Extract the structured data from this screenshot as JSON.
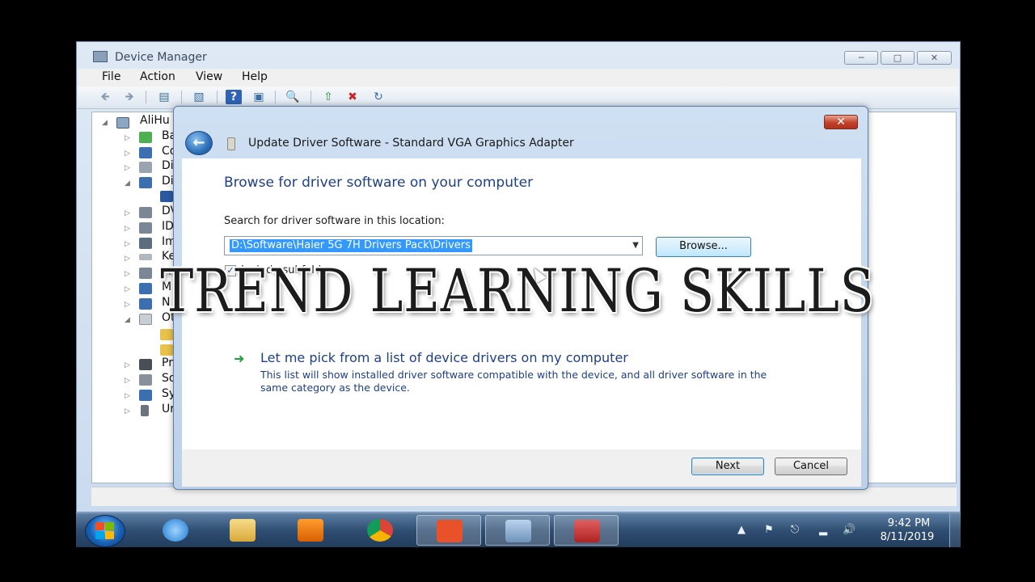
{
  "device_manager": {
    "title": "Device Manager",
    "menu": [
      "File",
      "Action",
      "View",
      "Help"
    ],
    "tree": [
      {
        "label": "AliHu",
        "icon": "computer-icon"
      },
      {
        "label": "Ba",
        "icon": "battery-icon"
      },
      {
        "label": "Co",
        "icon": "computer-icon"
      },
      {
        "label": "Di",
        "icon": "disk-drive-icon"
      },
      {
        "label": "Di",
        "icon": "display-adapter-icon"
      },
      {
        "label": "",
        "icon": "vga-adapter-icon"
      },
      {
        "label": "DV",
        "icon": "dvd-drive-icon"
      },
      {
        "label": "ID",
        "icon": "ide-controller-icon"
      },
      {
        "label": "Im",
        "icon": "imaging-device-icon"
      },
      {
        "label": "Ke",
        "icon": "keyboard-icon"
      },
      {
        "label": "M",
        "icon": "mouse-icon"
      },
      {
        "label": "M",
        "icon": "monitor-icon"
      },
      {
        "label": "N",
        "icon": "network-adapter-icon"
      },
      {
        "label": "Ot",
        "icon": "other-devices-icon"
      },
      {
        "label": "",
        "icon": "unknown-device-icon"
      },
      {
        "label": "",
        "icon": "unknown-device-icon"
      },
      {
        "label": "Pr",
        "icon": "processor-icon"
      },
      {
        "label": "So",
        "icon": "sound-icon"
      },
      {
        "label": "Sy",
        "icon": "system-devices-icon"
      },
      {
        "label": "Ur",
        "icon": "usb-controller-icon"
      }
    ]
  },
  "dialog": {
    "header": "Update Driver Software - Standard VGA Graphics Adapter",
    "heading": "Browse for driver software on your computer",
    "search_label": "Search for driver software in this location:",
    "path_value": "D:\\Software\\Haier 5G 7H Drivers Pack\\Drivers",
    "browse_label": "Browse...",
    "include_subfolders_label": "Include subfolders",
    "include_subfolders_checked": true,
    "pick_title": "Let me pick from a list of device drivers on my computer",
    "pick_description": "This list will show installed driver software compatible with the device, and all driver software in the same category as the device.",
    "next_label": "Next",
    "cancel_label": "Cancel"
  },
  "watermark": "TREND LEARNING SKILLS",
  "taskbar": {
    "apps": [
      "internet-explorer-icon",
      "windows-explorer-icon",
      "media-player-icon",
      "chrome-icon",
      "camtasia-icon",
      "device-manager-icon",
      "toolbox-icon"
    ],
    "clock_time": "9:42 PM",
    "clock_date": "8/11/2019"
  },
  "colors": {
    "heading_blue": "#1e3f8a",
    "selection_blue": "#3399ff",
    "close_red": "#c1422a"
  }
}
